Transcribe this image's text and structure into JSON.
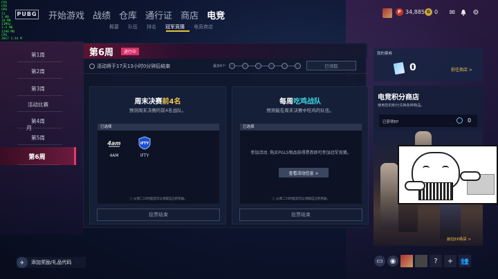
{
  "app": {
    "logo": "PUBG",
    "debug_lines": [
      "FPS",
      "CPU",
      "GPU",
      "11",
      "1 MB",
      "10 MB",
      "11MHz",
      "1.4 MB",
      "2290 MB",
      "CPU",
      "2017 1:44 M"
    ]
  },
  "nav": {
    "tabs": [
      "开始游戏",
      "战绩",
      "仓库",
      "通行证",
      "商店",
      "电竞"
    ],
    "active": "电竞",
    "subtabs": [
      "概要",
      "队伍",
      "排名",
      "冠军竞猜",
      "电竞商店"
    ],
    "active_sub": "冠军竞猜"
  },
  "currency": {
    "bp": "34,885",
    "g_coin": "0"
  },
  "sidebar": {
    "weeks": [
      "第1周",
      "第2周",
      "第3周",
      "活动比赛",
      "第4周",
      "第5周",
      "第6周"
    ],
    "active": "第6周",
    "moon": "月"
  },
  "main": {
    "week_title": "第6周",
    "status_badge": "进行中",
    "timer": "活动将于17天13小时0分钟后结束",
    "points_label": "最多6个",
    "claim_button": "已领取",
    "left_card": {
      "title_prefix": "周末决赛",
      "title_hl": "前4名",
      "subtitle": "预测周末决赛的前4名战队。",
      "selected_label": "已选择",
      "teams": [
        {
          "name": "4AM"
        },
        {
          "name": "iFTY"
        }
      ],
      "note": "ⓘ 从周二15时起您可以领取自己的奖励。",
      "vote_button": "投票结束"
    },
    "right_card": {
      "title_prefix": "每周",
      "title_hl": "吃鸡战队",
      "subtitle": "预测能在周末决赛中吃鸡的队伍。",
      "selected_label": "已选择",
      "empty_msg": "参加活动. 购买PGLS物品获得票券即可参加冠军竞猜。",
      "view_button": "查看活动信息 >",
      "note": "ⓘ 从周二15时起您可以领取自己的奖励。",
      "vote_button": "投票结束"
    }
  },
  "tickets": {
    "label": "我的票券",
    "count": "0",
    "go_shop": "前往商店 >"
  },
  "shop": {
    "title": "电竞积分商店",
    "subtitle": "使用您的积分兑换各种物品。",
    "ep_label": "已获得EP",
    "ep_value": "0",
    "go_shop": "前往EP商店 >"
  },
  "bottom": {
    "redeem": "添加奖励/礼品代码"
  }
}
